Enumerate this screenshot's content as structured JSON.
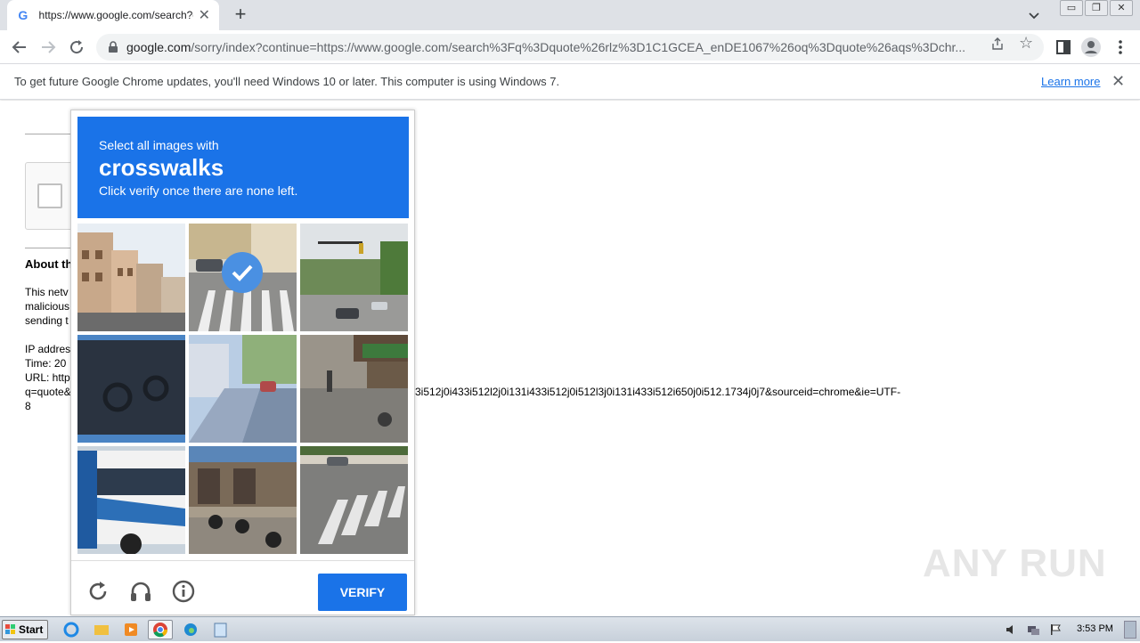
{
  "browser": {
    "tab_title": "https://www.google.com/search?q=",
    "url_host": "google.com",
    "url_path": "/sorry/index?continue=https://www.google.com/search%3Fq%3Dquote%26rlz%3D1C1GCEA_enDE1067%26oq%3Dquote%26aqs%3Dchr...",
    "favicon_letter": "G"
  },
  "infobar": {
    "message": "To get future Google Chrome updates, you'll need Windows 10 or later. This computer is using Windows 7.",
    "learn_more": "Learn more"
  },
  "page": {
    "about_heading": "About th",
    "para1": [
      "This netv",
      "malicious",
      "sending t"
    ],
    "para2": [
      "IP addres",
      "Time: 20",
      "URL: http",
      "q=quote&",
      "8"
    ],
    "url_tail": "3i512j0i433i512l2j0i131i433i512j0i512l3j0i131i433i512i650j0i512.1734j0j7&sourceid=chrome&ie=UTF-"
  },
  "captcha": {
    "line1": "Select all images with",
    "keyword": "crosswalks",
    "line3": "Click verify once there are none left.",
    "verify_label": "VERIFY",
    "tiles": [
      {
        "name": "buildings-street",
        "selected": false
      },
      {
        "name": "crosswalk-cars",
        "selected": true
      },
      {
        "name": "traffic-lights-street",
        "selected": false
      },
      {
        "name": "dark-motorcycle",
        "selected": false
      },
      {
        "name": "sidewalk-street",
        "selected": false
      },
      {
        "name": "market-street",
        "selected": false
      },
      {
        "name": "bus",
        "selected": false
      },
      {
        "name": "motorbikes-shops",
        "selected": false
      },
      {
        "name": "crosswalk-street",
        "selected": false
      }
    ],
    "accent_color": "#1a73e8"
  },
  "watermark": "ANY RUN",
  "taskbar": {
    "start_label": "Start",
    "clock": "3:53 PM"
  }
}
